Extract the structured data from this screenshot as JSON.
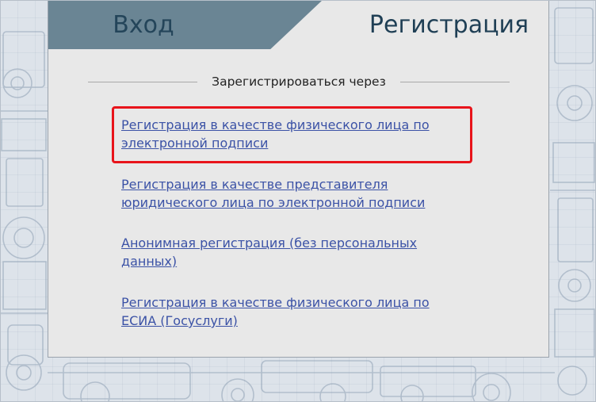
{
  "tabs": {
    "login_label": "Вход",
    "register_label": "Регистрация"
  },
  "register_section": {
    "heading": "Зарегистрироваться через",
    "options": [
      {
        "label": "Регистрация в качестве физического лица по электронной подписи",
        "highlighted": true
      },
      {
        "label": "Регистрация в качестве представителя юридического лица по электронной подписи",
        "highlighted": false
      },
      {
        "label": "Анонимная регистрация (без персональных данных)",
        "highlighted": false
      },
      {
        "label": "Регистрация в качестве физического лица по ЕСИА (Госуслуги)",
        "highlighted": false
      }
    ]
  },
  "colors": {
    "link": "#3b52a6",
    "active_tab_bg": "#6a8594",
    "highlight": "#e8141b",
    "panel_bg": "#e8e8e8"
  }
}
